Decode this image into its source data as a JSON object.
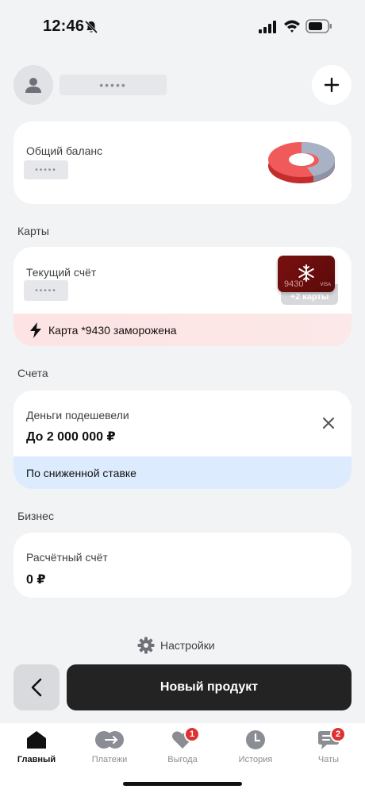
{
  "status_bar": {
    "time": "12:46"
  },
  "profile": {
    "name_mask": "•••••"
  },
  "balance": {
    "label": "Общий баланс",
    "value_mask": "•••••"
  },
  "cards_section": {
    "title": "Карты",
    "account_label": "Текущий счёт",
    "value_mask": "•••••",
    "card_number": "9430",
    "card_network": "VISA",
    "more_cards": "+2 карты",
    "frozen_notice": "Карта *9430 заморожена"
  },
  "accounts_section": {
    "title": "Счета",
    "promo_title": "Деньги подешевели",
    "promo_amount": "До 2 000 000 ₽",
    "promo_footer": "По сниженной ставке"
  },
  "business_section": {
    "title": "Бизнес",
    "account_label": "Расчётный счёт",
    "amount": "0 ₽"
  },
  "settings": {
    "label": "Настройки"
  },
  "actions": {
    "new_product": "Новый продукт"
  },
  "tabs": [
    {
      "label": "Главный",
      "icon": "home-icon",
      "badge": null,
      "active": true
    },
    {
      "label": "Платежи",
      "icon": "transfer-icon",
      "badge": null,
      "active": false
    },
    {
      "label": "Выгода",
      "icon": "heart-icon",
      "badge": "1",
      "active": false
    },
    {
      "label": "История",
      "icon": "clock-icon",
      "badge": null,
      "active": false
    },
    {
      "label": "Чаты",
      "icon": "chat-icon",
      "badge": "2",
      "active": false
    }
  ],
  "colors": {
    "accent_red": "#e03131",
    "frozen_bg": "#fde3e3",
    "promo_bg": "#dcebfd",
    "primary_button": "#232323",
    "card_red": "#7a1010"
  }
}
